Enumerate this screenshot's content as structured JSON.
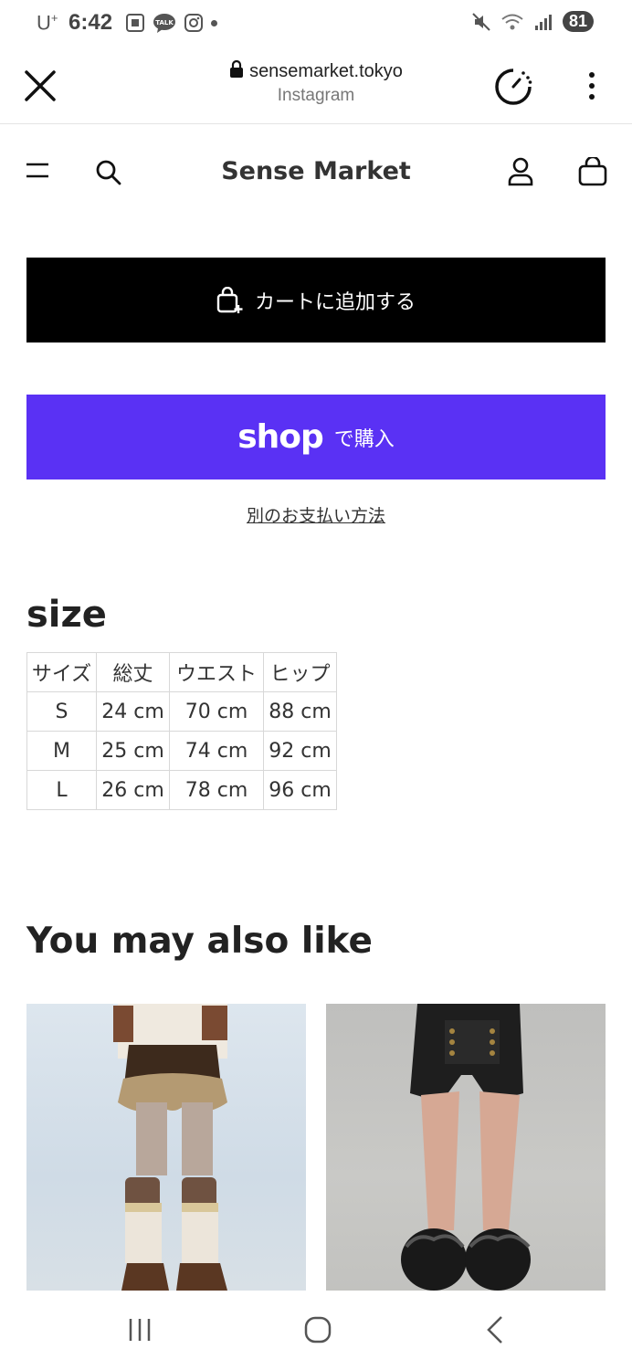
{
  "status_bar": {
    "carrier": "U",
    "carrier_sup": "+",
    "time": "6:42",
    "battery": "81",
    "left_icons": [
      "screenshot-icon",
      "talk-icon",
      "instagram-icon",
      "dot-icon"
    ],
    "right_icons": [
      "mute-icon",
      "wifi-icon",
      "signal-icon"
    ]
  },
  "browser": {
    "domain": "sensemarket.tokyo",
    "source": "Instagram"
  },
  "site_header": {
    "title": "Sense Market"
  },
  "buttons": {
    "add_to_cart": "カートに追加する",
    "shop_logo": "shop",
    "shop_buy": "で購入",
    "alt_payment": "別のお支払い方法"
  },
  "size": {
    "heading": "size",
    "headers": [
      "サイズ",
      "総丈",
      "ウエスト",
      "ヒップ"
    ],
    "rows": [
      [
        "S",
        "24 cm",
        "70 cm",
        "88 cm"
      ],
      [
        "M",
        "25 cm",
        "74 cm",
        "92 cm"
      ],
      [
        "L",
        "26 cm",
        "78 cm",
        "96 cm"
      ]
    ]
  },
  "recommendations": {
    "heading": "You may also like"
  },
  "colors": {
    "shop_purple": "#5a31f4",
    "cart_black": "#000000"
  }
}
